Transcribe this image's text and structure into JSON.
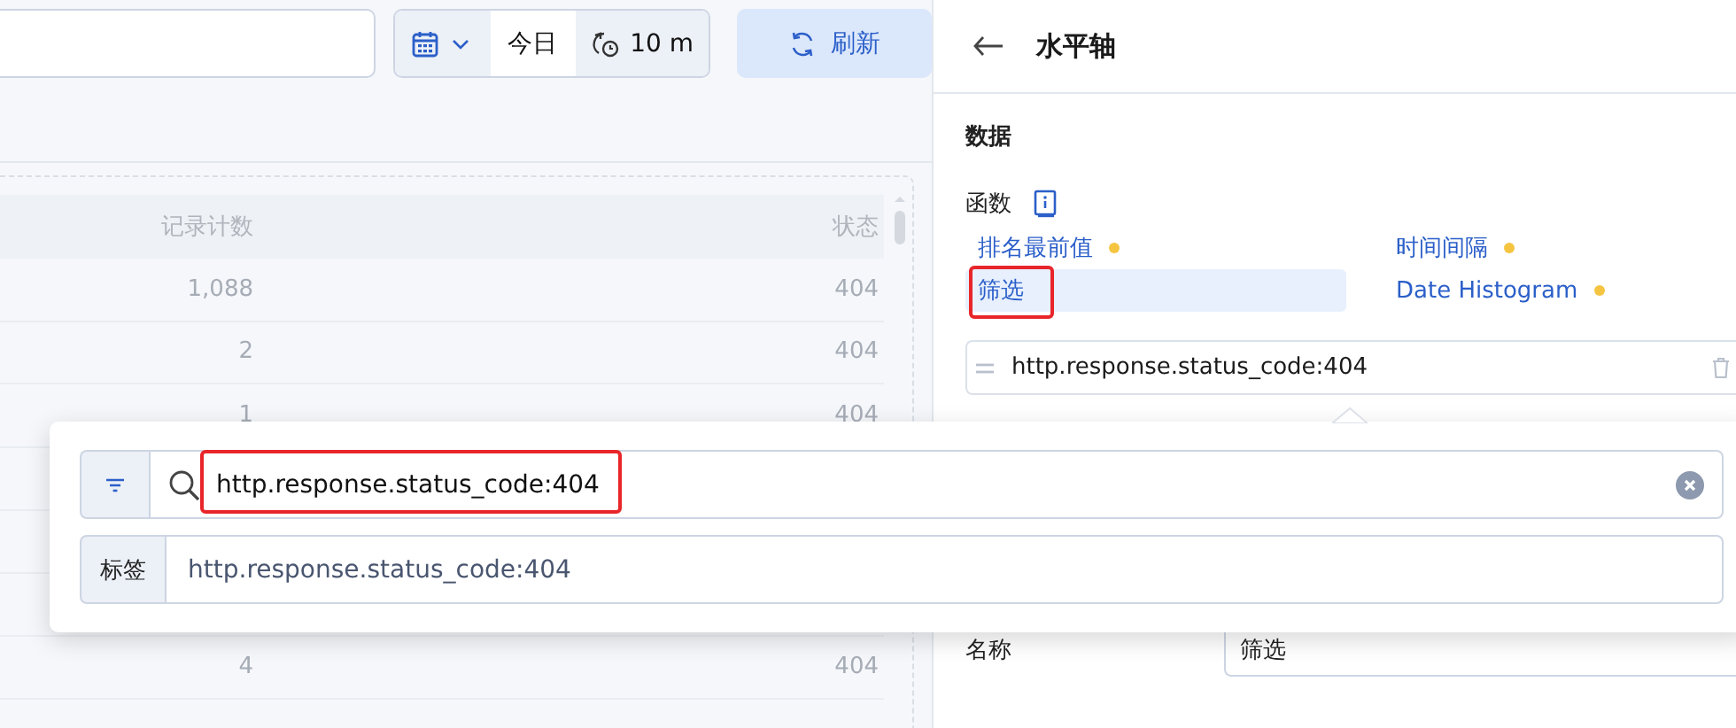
{
  "toolbar": {
    "date_range": "今日",
    "refresh_interval": "10 m",
    "refresh_button": "刷新"
  },
  "table": {
    "columns": [
      "记录计数",
      "状态"
    ],
    "rows": [
      {
        "cells": [
          "1,088",
          "404"
        ],
        "gap_before": false
      },
      {
        "cells": [
          "2",
          "404"
        ],
        "gap_before": false
      },
      {
        "cells": [
          "1",
          "404"
        ],
        "gap_before": false
      },
      {
        "cells": [
          "4",
          "404"
        ],
        "gap_before": true
      }
    ]
  },
  "panel": {
    "title": "水平轴",
    "section": "数据",
    "functions_label": "函数",
    "functions": [
      {
        "label": "排名最前值",
        "dot": true,
        "selected": false,
        "annotated": false
      },
      {
        "label": "时间间隔",
        "dot": true,
        "selected": false,
        "annotated": false
      },
      {
        "label": "筛选",
        "dot": false,
        "selected": true,
        "annotated": true
      },
      {
        "label": "Date Histogram",
        "dot": true,
        "selected": false,
        "annotated": false
      }
    ],
    "filter": "http.response.status_code:404",
    "name_label": "名称",
    "name_value": "筛选"
  },
  "popover": {
    "query": "http.response.status_code:404",
    "query_annotated": true,
    "label_addon": "标签",
    "label_value": "http.response.status_code:404"
  }
}
